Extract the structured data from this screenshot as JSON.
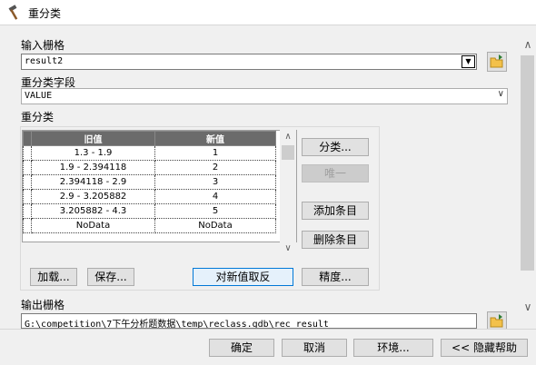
{
  "window": {
    "title": "重分类",
    "title_icon": "hammer-icon"
  },
  "input_raster": {
    "label": "输入栅格",
    "value": "result2"
  },
  "reclass_field": {
    "label": "重分类字段",
    "value": "VALUE"
  },
  "reclass": {
    "label": "重分类",
    "columns": [
      "旧值",
      "新值"
    ],
    "rows": [
      {
        "old": "1.3 - 1.9",
        "new": "1"
      },
      {
        "old": "1.9 - 2.394118",
        "new": "2"
      },
      {
        "old": "2.394118 - 2.9",
        "new": "3"
      },
      {
        "old": "2.9 - 3.205882",
        "new": "4"
      },
      {
        "old": "3.205882 - 4.3",
        "new": "5"
      },
      {
        "old": "NoData",
        "new": "NoData"
      }
    ],
    "buttons": {
      "classify": "分类...",
      "unique": "唯一",
      "add_entry": "添加条目",
      "delete_entry": "删除条目",
      "load": "加载...",
      "save": "保存...",
      "reverse": "对新值取反",
      "precision": "精度..."
    }
  },
  "output_raster": {
    "label": "输出栅格",
    "value": "G:\\competition\\7下午分析题数据\\temp\\reclass.gdb\\rec_result"
  },
  "footer": {
    "ok": "确定",
    "cancel": "取消",
    "env": "环境...",
    "hide_help": "<< 隐藏帮助"
  }
}
